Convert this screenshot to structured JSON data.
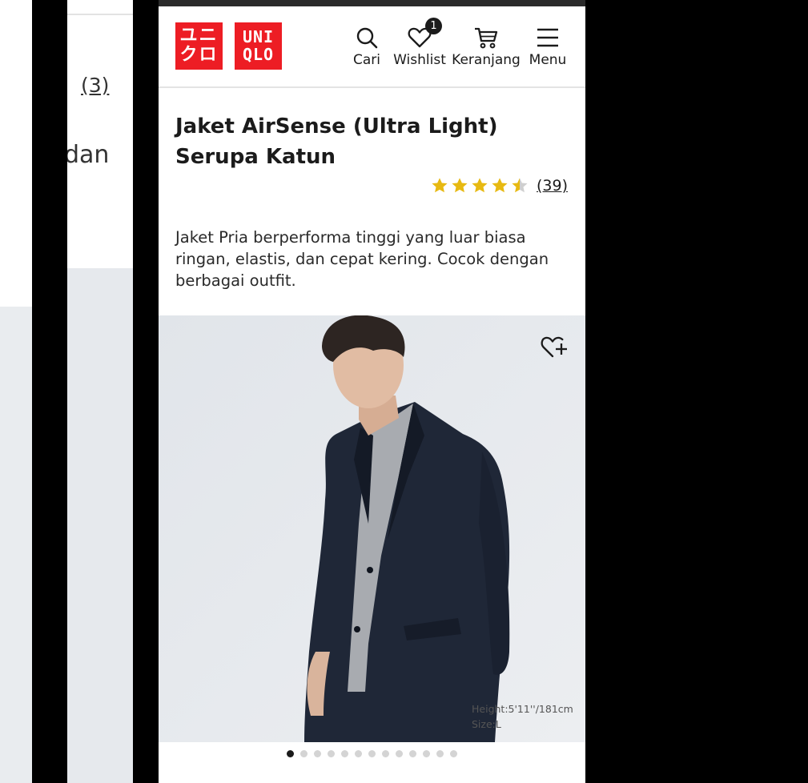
{
  "background": {
    "prev_card_count": "(3)",
    "prev_card_text": "dan"
  },
  "header": {
    "logo_top_left": "ユニ",
    "logo_bottom_left": "クロ",
    "logo_top_right": "UNI",
    "logo_bottom_right": "QLO",
    "nav": {
      "search_label": "Cari",
      "wishlist_label": "Wishlist",
      "wishlist_badge": "1",
      "cart_label": "Keranjang",
      "menu_label": "Menu"
    }
  },
  "product": {
    "title": "Jaket AirSense (Ultra Light) Serupa Katun",
    "rating": 4.5,
    "review_count": "(39)",
    "description": "Jaket Pria berperforma tinggi yang luar biasa ringan, elastis, dan cepat kering. Cocok dengan berbagai outfit."
  },
  "image": {
    "model_height": "Height:5'11''/181cm",
    "model_size": "Size:L",
    "carousel_total": 13,
    "carousel_active": 1
  },
  "colors": {
    "brand_red": "#ed1d24",
    "star_gold": "#e7b912"
  }
}
